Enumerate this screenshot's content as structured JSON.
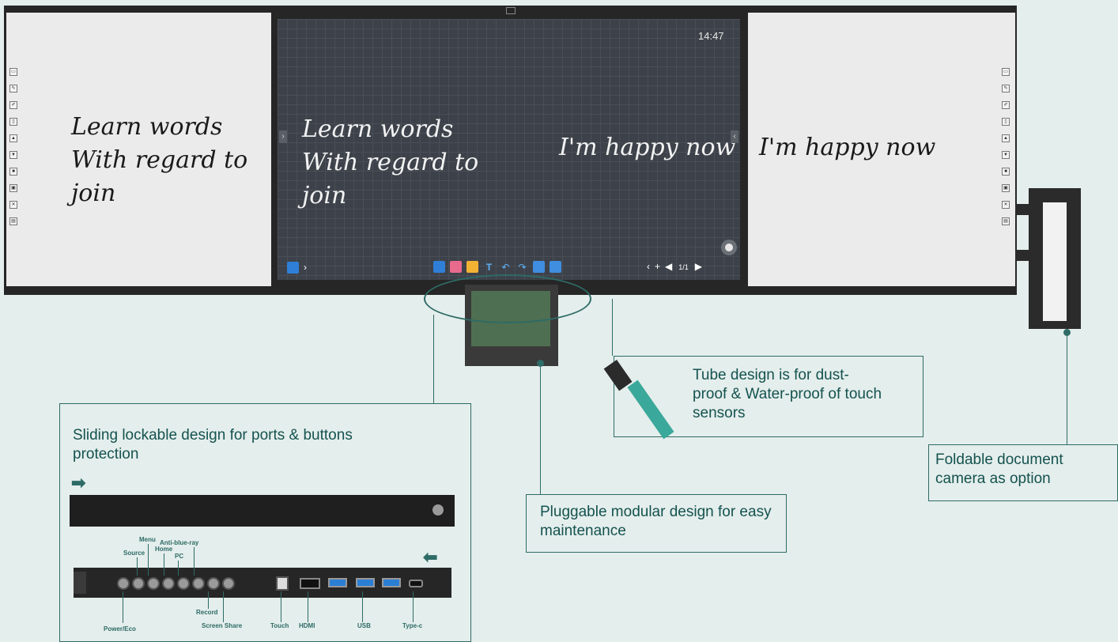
{
  "board": {
    "clock": "14:47",
    "left_text": [
      "Learn words",
      "With regard to",
      "join"
    ],
    "right_text": "I'm happy now",
    "page_indicator": "1/1",
    "side_tools": [
      "split-icon",
      "pen-icon",
      "marker-icon",
      "page-icon",
      "upload-icon",
      "download-icon",
      "lock-icon",
      "save-icon",
      "close-icon",
      "gallery-icon"
    ]
  },
  "callouts": {
    "sliding": "Sliding lockable design for ports & buttons protection",
    "tube": "Tube design is for dust-proof & Water-proof of touch sensors",
    "pluggable": "Pluggable modular design for easy maintenance",
    "camera": "Foldable document camera as option"
  },
  "ports": {
    "menu": "Menu",
    "source": "Source",
    "home": "Home",
    "pc": "PC",
    "anti_blue_ray": "Anti-blue-ray",
    "record": "Record",
    "screen_share": "Screen Share",
    "power_eco": "Power/Eco",
    "touch": "Touch",
    "hdmi": "HDMI",
    "usb": "USB",
    "type_c": "Type-c"
  },
  "colors": {
    "accent": "#2e6b66",
    "background": "#e4eeec",
    "board": "#3d424a"
  }
}
